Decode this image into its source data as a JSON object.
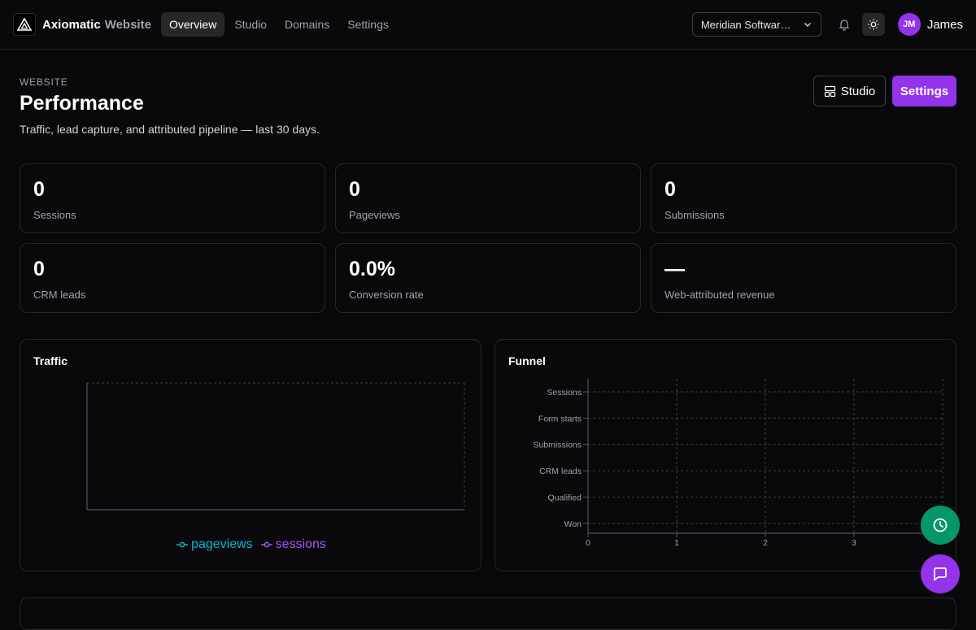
{
  "header": {
    "brand": "Axiomatic",
    "brand_sub": "Website",
    "tabs": [
      {
        "label": "Overview",
        "active": true
      },
      {
        "label": "Studio",
        "active": false
      },
      {
        "label": "Domains",
        "active": false
      },
      {
        "label": "Settings",
        "active": false
      }
    ],
    "org_select": "Meridian Software Inc",
    "user_initials": "JM",
    "user_name": "James"
  },
  "page": {
    "eyebrow": "WEBSITE",
    "title": "Performance",
    "subtitle": "Traffic, lead capture, and attributed pipeline — last 30 days.",
    "studio_button": "Studio",
    "settings_button": "Settings"
  },
  "stats": [
    {
      "value": "0",
      "label": "Sessions"
    },
    {
      "value": "0",
      "label": "Pageviews"
    },
    {
      "value": "0",
      "label": "Submissions"
    },
    {
      "value": "0",
      "label": "CRM leads"
    },
    {
      "value": "0.0%",
      "label": "Conversion rate"
    },
    {
      "value": "—",
      "label": "Web-attributed revenue"
    }
  ],
  "colors": {
    "accent": "#9333ea",
    "pageviews": "#06b6d4",
    "sessions": "#a855f7",
    "fab_history": "#059669"
  },
  "chart_data": [
    {
      "type": "line",
      "title": "Traffic",
      "x": [],
      "series": [
        {
          "name": "pageviews",
          "values": []
        },
        {
          "name": "sessions",
          "values": []
        }
      ],
      "legend": "bottom",
      "grid": true
    },
    {
      "type": "bar",
      "orientation": "horizontal",
      "title": "Funnel",
      "categories": [
        "Sessions",
        "Form starts",
        "Submissions",
        "CRM leads",
        "Qualified",
        "Won"
      ],
      "values": [
        0,
        0,
        0,
        0,
        0,
        0
      ],
      "xlim": [
        0,
        4
      ],
      "xticks": [
        "0",
        "1",
        "2",
        "3"
      ],
      "grid": true
    }
  ],
  "icons": {
    "logo": "triangle-logo-icon",
    "bell": "bell-icon",
    "theme": "sun-icon",
    "history": "clock-icon",
    "chat": "chat-icon"
  }
}
